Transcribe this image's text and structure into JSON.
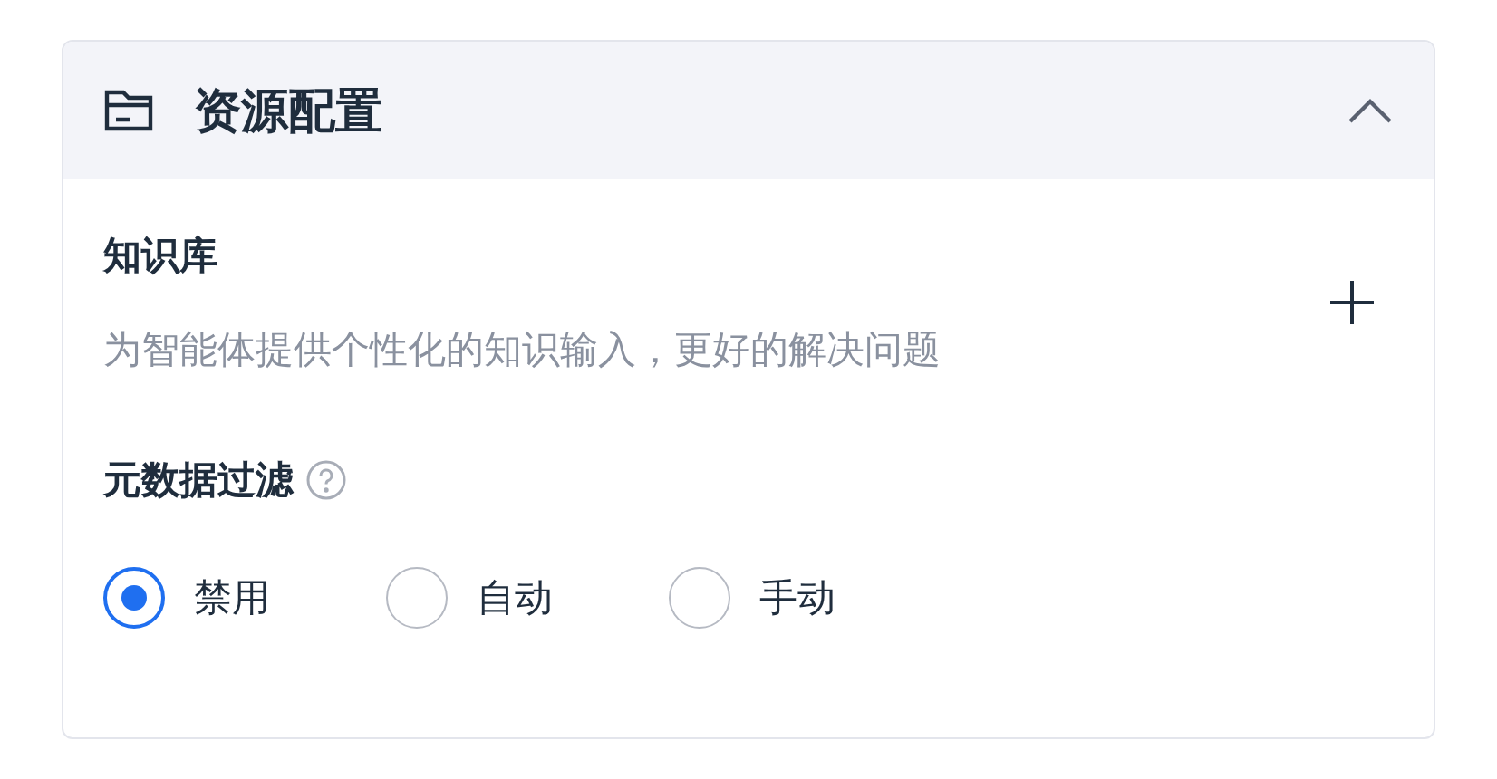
{
  "panel": {
    "title": "资源配置",
    "expanded": true
  },
  "knowledge": {
    "label": "知识库",
    "description": "为智能体提供个性化的知识输入，更好的解决问题"
  },
  "metadata_filter": {
    "label": "元数据过滤",
    "options": [
      {
        "label": "禁用",
        "selected": true
      },
      {
        "label": "自动",
        "selected": false
      },
      {
        "label": "手动",
        "selected": false
      }
    ]
  }
}
